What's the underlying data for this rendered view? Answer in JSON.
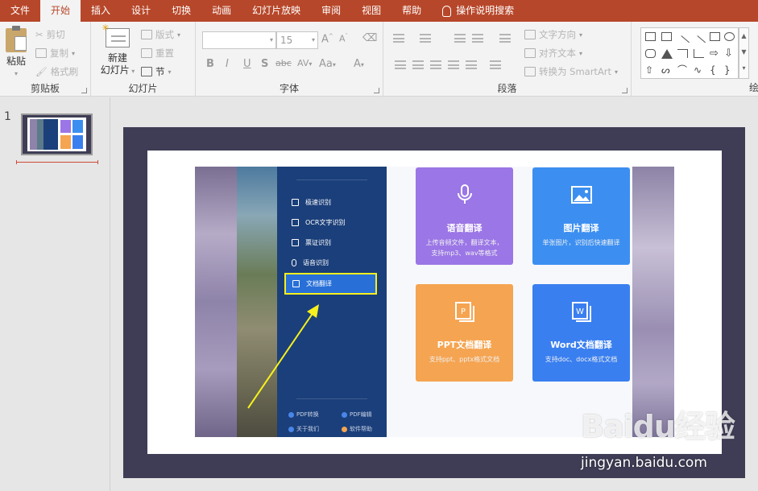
{
  "tabs": [
    "文件",
    "开始",
    "插入",
    "设计",
    "切换",
    "动画",
    "幻灯片放映",
    "审阅",
    "视图",
    "帮助"
  ],
  "tell_me": "操作说明搜索",
  "ribbon": {
    "clipboard": {
      "paste": "粘贴",
      "cut": "剪切",
      "copy": "复制",
      "format_painter": "格式刷",
      "label": "剪贴板"
    },
    "slides": {
      "new_slide_l1": "新建",
      "new_slide_l2": "幻灯片",
      "layout": "版式",
      "reset": "重置",
      "section": "节",
      "label": "幻灯片"
    },
    "font": {
      "size": "15",
      "bold": "B",
      "italic": "I",
      "underline": "U",
      "shadow": "S",
      "strike": "abc",
      "spacing": "AV",
      "case": "Aa",
      "color": "A",
      "grow": "A",
      "shrink": "A",
      "label": "字体"
    },
    "paragraph": {
      "text_direction": "文字方向",
      "align_text": "对齐文本",
      "smartart": "转换为 SmartArt",
      "label": "段落"
    },
    "drawing_label": "绘"
  },
  "thumbnail": {
    "number": "1"
  },
  "slide_app": {
    "menu": [
      "极速识别",
      "OCR文字识别",
      "票证识别",
      "语音识别",
      "文档翻译"
    ],
    "footer": [
      "PDF转换",
      "PDF编辑",
      "关于我们",
      "软件帮助"
    ],
    "cards": [
      {
        "title": "语音翻译",
        "desc_l1": "上传音频文件，翻译文本，",
        "desc_l2": "支持mp3、wav等格式",
        "color": "#9b76e6",
        "icon": "microphone-icon"
      },
      {
        "title": "图片翻译",
        "desc_l1": "单张图片，识别后快速翻译",
        "desc_l2": "",
        "color": "#3c8ff1",
        "icon": "image-icon"
      },
      {
        "title": "PPT文档翻译",
        "desc_l1": "支持ppt、pptx格式文档",
        "desc_l2": "",
        "color": "#f5a451",
        "icon": "ppt-file-icon"
      },
      {
        "title": "Word文档翻译",
        "desc_l1": "支持doc、docx格式文档",
        "desc_l2": "",
        "color": "#3a7ff0",
        "icon": "word-file-icon"
      }
    ]
  },
  "watermark": {
    "logo": "Baidu经验",
    "url": "jingyan.baidu.com"
  }
}
